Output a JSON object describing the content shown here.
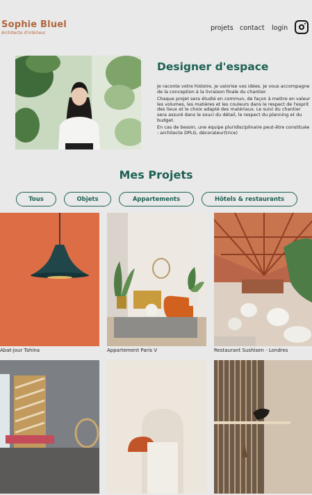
{
  "header": {
    "logo_name": "Sophie Bluel",
    "logo_subtitle": "Architecte d'intérieur",
    "nav": [
      "projets",
      "contact",
      "login"
    ],
    "instagram_icon": "instagram-icon"
  },
  "about": {
    "title": "Designer d'espace",
    "paragraphs": [
      "Je raconte votre histoire, je valorise vos idées. Je vous accompagne de la conception à la livraison finale du chantier.",
      "Chaque projet sera étudié en commun, de façon à mettre en valeur les volumes, les matières et les couleurs dans le respect de l'esprit des lieux et le choix adapté des matériaux. Le suivi du chantier sera assuré dans le souci du détail, le respect du planning et du budget.",
      "En cas de besoin, une équipe pluridisciplinaire peut-être constituée : architecte DPLG, décorateur(trice)"
    ]
  },
  "projects": {
    "title": "Mes Projets",
    "filters": [
      "Tous",
      "Objets",
      "Appartements",
      "Hôtels & restaurants"
    ],
    "items": [
      {
        "caption": "Abat-jour Tahina"
      },
      {
        "caption": "Appartement Paris V"
      },
      {
        "caption": "Restaurant Sushisen - Londres"
      },
      {
        "caption": ""
      },
      {
        "caption": ""
      },
      {
        "caption": ""
      }
    ]
  },
  "colors": {
    "brand_green": "#1d6154",
    "logo_orange": "#b1663c",
    "background": "#e9e9e9"
  }
}
